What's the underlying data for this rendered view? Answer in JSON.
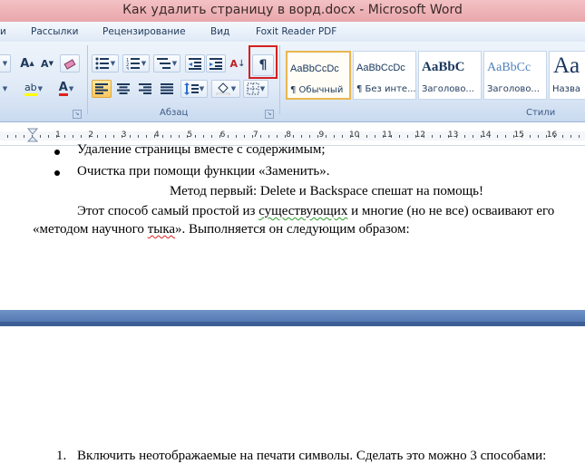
{
  "window": {
    "title": "Как удалить страницу в ворд.docx - Microsoft Word"
  },
  "ribbon_tabs": [
    {
      "label": "и"
    },
    {
      "label": "Рассылки"
    },
    {
      "label": "Рецензирование"
    },
    {
      "label": "Вид"
    },
    {
      "label": "Foxit Reader PDF"
    }
  ],
  "groups": {
    "paragraph": "Абзац",
    "styles": "Стили"
  },
  "buttons": {
    "grow_font": "A",
    "shrink_font": "A",
    "sort": "А",
    "pilcrow": "¶",
    "font_color": "A",
    "highlight": "ab"
  },
  "styles": [
    {
      "sample": "AaBbCcDc",
      "name": "¶ Обычный"
    },
    {
      "sample": "AaBbCcDc",
      "name": "¶ Без инте..."
    },
    {
      "sample": "AaBbC",
      "name": "Заголово..."
    },
    {
      "sample": "AaBbCc",
      "name": "Заголово..."
    },
    {
      "sample": "Aa",
      "name": "Назва"
    }
  ],
  "ruler": {
    "numbers": [
      "1",
      "2",
      "3",
      "4",
      "5",
      "6",
      "7",
      "8",
      "9",
      "10",
      "11",
      "12",
      "13",
      "14",
      "15",
      "16"
    ]
  },
  "document": {
    "bullet1": "Удаление страницы вместе с содержимым;",
    "bullet2": "Очистка при помощи функции «Заменить».",
    "heading": "Метод первый: Delete и Backspace спешат на помощь!",
    "para_a": "Этот способ самый простой из ",
    "para_b": "существующих",
    "para_c": " и многие (но не все) осваивают его",
    "para2_a": "«методом научного ",
    "para2_b": "тыка",
    "para2_c": "». Выполняется он следующим образом:",
    "list_number": "1.",
    "list_text": "Включить неотображаемые на печати символы. Сделать это можно 3 способами:"
  },
  "colors": {
    "title_bar": "#eeb0b4",
    "ribbon": "#dfe9f6",
    "page_gap": "#5a7fb8",
    "highlight_box": "#d42020"
  }
}
